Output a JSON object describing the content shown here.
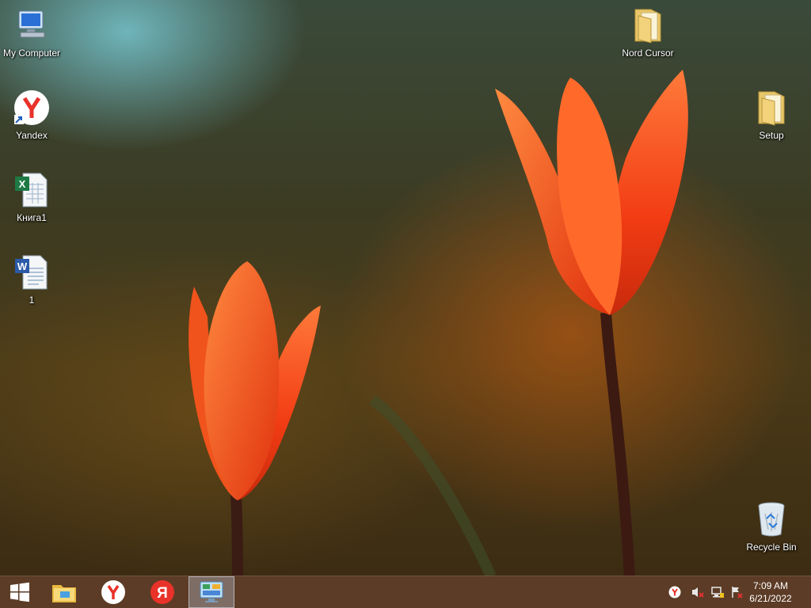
{
  "desktop": {
    "icons": [
      {
        "label": "My Computer",
        "icon": "computer-icon"
      },
      {
        "label": "Yandex",
        "icon": "yandex-browser-icon"
      },
      {
        "label": "Книга1",
        "icon": "excel-file-icon"
      },
      {
        "label": "1",
        "icon": "word-file-icon"
      },
      {
        "label": "Nord Cursor",
        "icon": "folder-icon"
      },
      {
        "label": "Setup",
        "icon": "folder-icon"
      },
      {
        "label": "Recycle Bin",
        "icon": "recycle-bin-icon"
      }
    ]
  },
  "taskbar": {
    "pinned": [
      "start-button",
      "file-explorer",
      "yandex-browser",
      "yandex-search",
      "control-panel"
    ],
    "tray": [
      "yandex-tray-icon",
      "speaker-muted-icon",
      "network-icon",
      "action-center-icon"
    ],
    "clock": {
      "time": "7:09 AM",
      "date": "6/21/2022"
    }
  },
  "colors": {
    "taskbar": "#5f3e28",
    "tulip": "#f2461a",
    "wallpaper_dark": "#3a2a12"
  }
}
